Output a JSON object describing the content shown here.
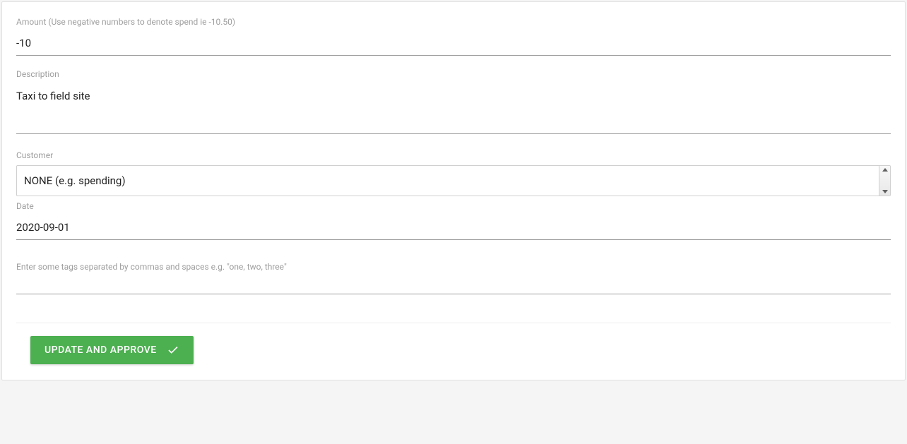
{
  "form": {
    "amount": {
      "label": "Amount (Use negative numbers to denote spend ie -10.50)",
      "value": "-10"
    },
    "description": {
      "label": "Description",
      "value": "Taxi to field site"
    },
    "customer": {
      "label": "Customer",
      "selected": "NONE (e.g. spending)"
    },
    "date": {
      "label": "Date",
      "value": "2020-09-01"
    },
    "tags": {
      "placeholder": "Enter some tags separated by commas and spaces e.g. \"one, two, three\"",
      "value": ""
    }
  },
  "actions": {
    "submit_label": "UPDATE AND APPROVE"
  },
  "colors": {
    "primary": "#4caf50",
    "label": "#9e9e9e",
    "text": "#222222",
    "underline": "#9e9e9e"
  }
}
